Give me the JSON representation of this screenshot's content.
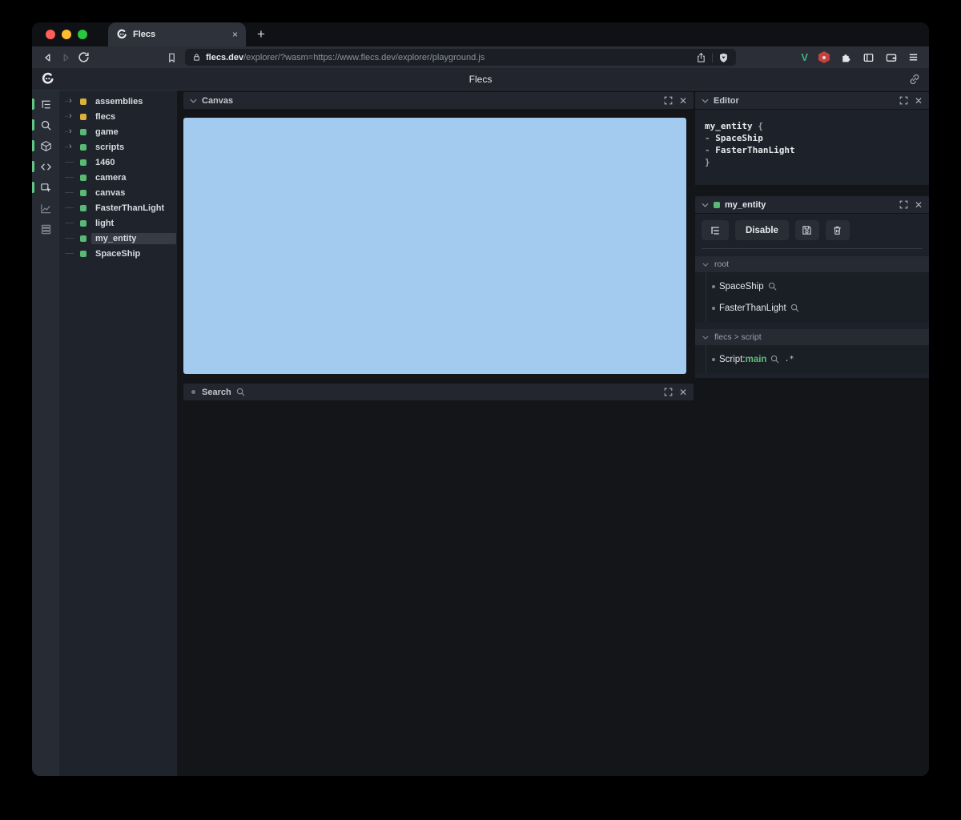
{
  "browser": {
    "tab": {
      "title": "Flecs",
      "close_label": "×",
      "new_tab_label": "+"
    },
    "address": {
      "domain": "flecs.dev",
      "path": "/explorer/?wasm=https://www.flecs.dev/explorer/playground.js"
    }
  },
  "app": {
    "header": {
      "title": "Flecs"
    },
    "sidebar": {
      "items": [
        {
          "icon": "tree-view",
          "active": true
        },
        {
          "icon": "query-search",
          "active": true
        },
        {
          "icon": "entities-cube",
          "active": true
        },
        {
          "icon": "code-editor",
          "active": true
        },
        {
          "icon": "inspector",
          "active": true
        },
        {
          "icon": "statistics-chart",
          "active": false
        },
        {
          "icon": "data-tables",
          "active": false
        }
      ]
    },
    "tree": {
      "items": [
        {
          "label": "assemblies",
          "kind": "module",
          "expandable": true,
          "selected": false
        },
        {
          "label": "flecs",
          "kind": "module",
          "expandable": true,
          "selected": false
        },
        {
          "label": "game",
          "kind": "entity",
          "expandable": true,
          "selected": false
        },
        {
          "label": "scripts",
          "kind": "entity",
          "expandable": true,
          "selected": false
        },
        {
          "label": "1460",
          "kind": "entity",
          "expandable": false,
          "selected": false
        },
        {
          "label": "camera",
          "kind": "entity",
          "expandable": false,
          "selected": false
        },
        {
          "label": "canvas",
          "kind": "entity",
          "expandable": false,
          "selected": false
        },
        {
          "label": "FasterThanLight",
          "kind": "entity",
          "expandable": false,
          "selected": false
        },
        {
          "label": "light",
          "kind": "entity",
          "expandable": false,
          "selected": false
        },
        {
          "label": "my_entity",
          "kind": "entity",
          "expandable": false,
          "selected": true
        },
        {
          "label": "SpaceShip",
          "kind": "entity",
          "expandable": false,
          "selected": false
        }
      ]
    },
    "canvas_panel": {
      "title": "Canvas"
    },
    "search_panel": {
      "title": "Search"
    },
    "editor_panel": {
      "title": "Editor",
      "lines": [
        [
          {
            "t": "my_entity ",
            "c": "fg"
          },
          {
            "t": "{",
            "c": "dim"
          }
        ],
        [
          {
            "t": "  - ",
            "c": "dim"
          },
          {
            "t": "SpaceShip",
            "c": "fg"
          }
        ],
        [
          {
            "t": "  - ",
            "c": "dim"
          },
          {
            "t": "FasterThanLight",
            "c": "fg"
          }
        ],
        [
          {
            "t": "}",
            "c": "dim"
          }
        ]
      ]
    },
    "entity_panel": {
      "title": "my_entity",
      "buttons": {
        "disable": "Disable"
      },
      "sections": [
        {
          "title": "root",
          "items": [
            {
              "label": "SpaceShip",
              "value": "",
              "extra": ""
            },
            {
              "label": "FasterThanLight",
              "value": "",
              "extra": ""
            }
          ]
        },
        {
          "title": "flecs > script",
          "items": [
            {
              "label": "Script: ",
              "value": "main",
              "extra": ".*"
            }
          ]
        }
      ]
    }
  },
  "colors": {
    "module_square": "#d9b13b",
    "entity_square": "#58ba74",
    "canvas_blue": "#a3cbef",
    "script_value_green": "#5fbf77",
    "active_pill_green": "#5fc886",
    "vue_green": "#3fb27f",
    "extension_red": "#c4413d",
    "traffic_close": "#ff5f57",
    "traffic_min": "#febc2e",
    "traffic_zoom": "#28c840"
  }
}
